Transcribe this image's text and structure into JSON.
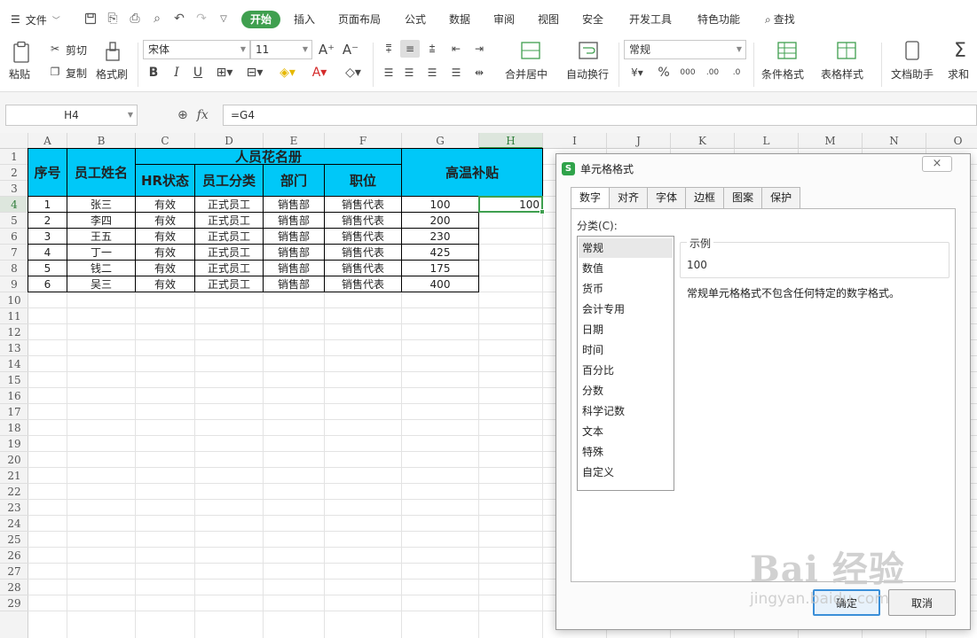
{
  "menubar": {
    "file_label": "文件",
    "tabs": [
      "开始",
      "插入",
      "页面布局",
      "公式",
      "数据",
      "审阅",
      "视图",
      "安全",
      "开发工具",
      "特色功能"
    ],
    "active_tab": "开始",
    "search_label": "查找"
  },
  "ribbon": {
    "paste": "粘贴",
    "cut": "剪切",
    "copy": "复制",
    "format_painter": "格式刷",
    "font_name": "宋体",
    "font_size": "11",
    "merge_center": "合并居中",
    "wrap_text": "自动换行",
    "number_format": "常规",
    "conditional_format": "条件格式",
    "table_style": "表格样式",
    "doc_helper": "文档助手",
    "sum": "求和"
  },
  "formula_bar": {
    "cell_ref": "H4",
    "fx": "fx",
    "formula": "=G4"
  },
  "sheet": {
    "columns": [
      "A",
      "B",
      "C",
      "D",
      "E",
      "F",
      "G",
      "H",
      "I",
      "J",
      "K",
      "L",
      "M",
      "N",
      "O"
    ],
    "selected_column": "H",
    "rows": [
      "1",
      "2",
      "3",
      "4",
      "5",
      "6",
      "7",
      "8",
      "9",
      "10",
      "11",
      "12",
      "13",
      "14",
      "15",
      "16",
      "17",
      "18",
      "19",
      "20",
      "21",
      "22",
      "23",
      "24",
      "25",
      "26",
      "27",
      "28",
      "29"
    ],
    "selected_row": "4",
    "table": {
      "title": "人员花名册",
      "headers": {
        "seq": "序号",
        "name": "员工姓名",
        "hr": "HR状态",
        "type": "员工分类",
        "dept": "部门",
        "pos": "职位",
        "allowance": "高温补贴"
      },
      "rows": [
        [
          "1",
          "张三",
          "有效",
          "正式员工",
          "销售部",
          "销售代表",
          "100",
          "100"
        ],
        [
          "2",
          "李四",
          "有效",
          "正式员工",
          "销售部",
          "销售代表",
          "200",
          ""
        ],
        [
          "3",
          "王五",
          "有效",
          "正式员工",
          "销售部",
          "销售代表",
          "230",
          ""
        ],
        [
          "4",
          "丁一",
          "有效",
          "正式员工",
          "销售部",
          "销售代表",
          "425",
          ""
        ],
        [
          "5",
          "钱二",
          "有效",
          "正式员工",
          "销售部",
          "销售代表",
          "175",
          ""
        ],
        [
          "6",
          "吴三",
          "有效",
          "正式员工",
          "销售部",
          "销售代表",
          "400",
          ""
        ]
      ]
    }
  },
  "dialog": {
    "title": "单元格格式",
    "logo": "S",
    "close": "×",
    "tabs": [
      "数字",
      "对齐",
      "字体",
      "边框",
      "图案",
      "保护"
    ],
    "active_tab": "数字",
    "category_label": "分类(C):",
    "categories": [
      "常规",
      "数值",
      "货币",
      "会计专用",
      "日期",
      "时间",
      "百分比",
      "分数",
      "科学记数",
      "文本",
      "特殊",
      "自定义"
    ],
    "selected_category": "常规",
    "sample_label": "示例",
    "sample_value": "100",
    "description": "常规单元格格式不包含任何特定的数字格式。",
    "ok": "确定",
    "cancel": "取消"
  },
  "watermark": {
    "main": "Bai 经验",
    "sub": "jingyan.baidu.com"
  }
}
